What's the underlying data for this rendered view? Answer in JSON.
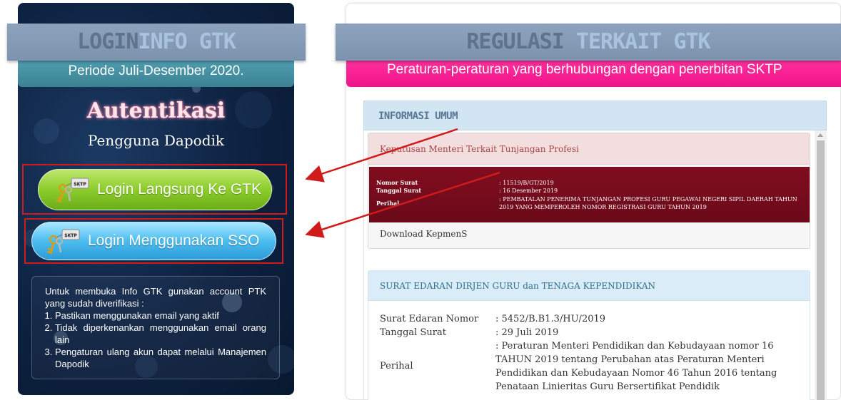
{
  "left": {
    "header_part1": "LOGIN",
    "header_part2": "INFO GTK",
    "period": "Periode Juli-Desember 2020.",
    "auth_title": "Autentikasi",
    "auth_subtitle": "Pengguna Dapodik",
    "btn_gtk_label": "Login Langsung Ke GTK",
    "btn_sso_label": "Login Menggunakan SSO",
    "key_tag": "SKTP",
    "info_intro": "Untuk membuka Info GTK gunakan account PTK yang sudah diverifikasi :",
    "info_items": [
      "Pastikan menggunakan email yang aktif",
      "Tidak diperkenankan menggunakan email orang lain",
      "Pengaturan ulang akun dapat melalui Manajemen Dapodik"
    ]
  },
  "right": {
    "header_part1": "REGULASI",
    "header_part2": "TERKAIT GTK",
    "subtitle": "Peraturan-peraturan yang berhubungan dengan penerbitan SKTP",
    "section_title": "INFORMASI UMUM",
    "card1": {
      "heading": "Keputusan Menteri Terkait Tunjangan Profesi",
      "nomor_label": "Nomor Surat",
      "nomor_value": ": 11519/B/GT/2019",
      "tanggal_label": "Tanggal Surat",
      "tanggal_value": ": 16 Desember 2019",
      "perihal_label": "Perihal",
      "perihal_value": ": PEMBATALAN PENERIMA TUNJANGAN PROFESI GURU PEGAWAI NEGERI SIPIL DAERAH TAHUN 2019 YANG MEMPEROLEH NOMOR REGISTRASI GURU TAHUN 2019",
      "download_label": "Download KepmenS"
    },
    "card2": {
      "heading": "SURAT EDARAN DIRJEN GURU dan TENAGA KEPENDIDIKAN",
      "nomor_label": "Surat Edaran Nomor",
      "nomor_value": ": 5452/B.B1.3/HU/2019",
      "tanggal_label": "Tanggal Surat",
      "tanggal_value": ": 29 Juli 2019",
      "perihal_label": "Perihal",
      "perihal_value": ": Peraturan Menteri Pendidikan dan Kebudayaan nomor 16 TAHUN 2019 tentang Perubahan atas Peraturan Menteri Pendidikan dan Kebudayaan Nomor 46 Tahun 2016 tentang Penataan Linieritas Guru Bersertifikat Pendidik"
    }
  },
  "colors": {
    "left_panel_bg": "#0d2140",
    "header_bar": "#8da3bd",
    "period_bar": "#4f9db0",
    "gtk_button": "#8ccc2c",
    "sso_button": "#4cbdf0",
    "magenta_bar": "#ef138a",
    "annotation_red": "#d11a1a"
  }
}
